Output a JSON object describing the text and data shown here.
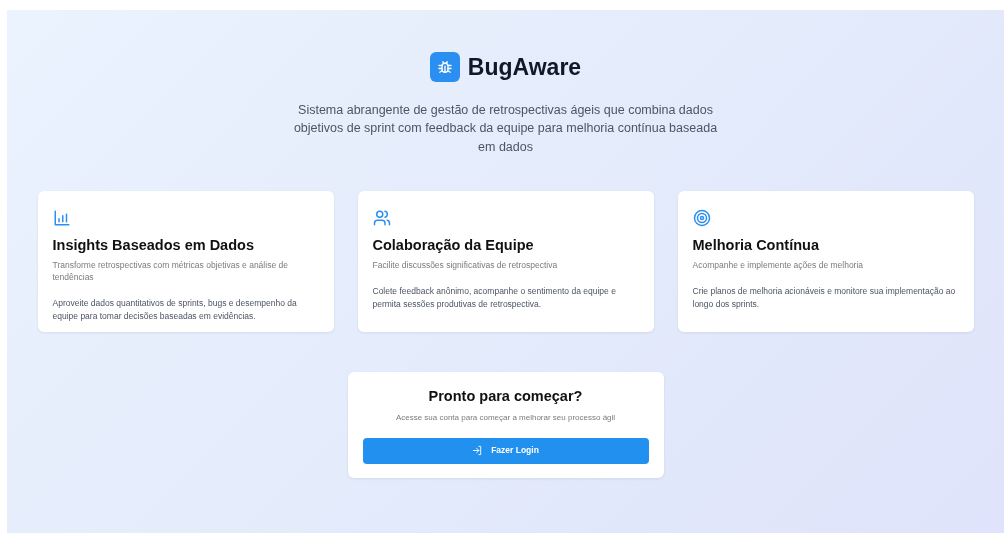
{
  "brand": {
    "name": "BugAware",
    "tagline": "Sistema abrangente de gestão de retrospectivas ágeis que combina dados objetivos de sprint com feedback da equipe para melhoria contínua baseada em dados"
  },
  "features": [
    {
      "kind": "chart",
      "title": "Insights Baseados em Dados",
      "subtitle": "Transforme retrospectivas com métricas objetivas e análise de tendências",
      "body": "Aproveite dados quantitativos de sprints, bugs e desempenho da equipe para tomar decisões baseadas em evidências."
    },
    {
      "kind": "users",
      "title": "Colaboração da Equipe",
      "subtitle": "Facilite discussões significativas de retrospectiva",
      "body": "Colete feedback anônimo, acompanhe o sentimento da equipe e permita sessões produtivas de retrospectiva."
    },
    {
      "kind": "target",
      "title": "Melhoria Contínua",
      "subtitle": "Acompanhe e implemente ações de melhoria",
      "body": "Crie planos de melhoria acionáveis e monitore sua implementação ao longo dos sprints."
    }
  ],
  "cta": {
    "title": "Pronto para começar?",
    "subtitle": "Acesse sua conta para começar a melhorar seu processo ágil",
    "button": "Fazer Login"
  }
}
